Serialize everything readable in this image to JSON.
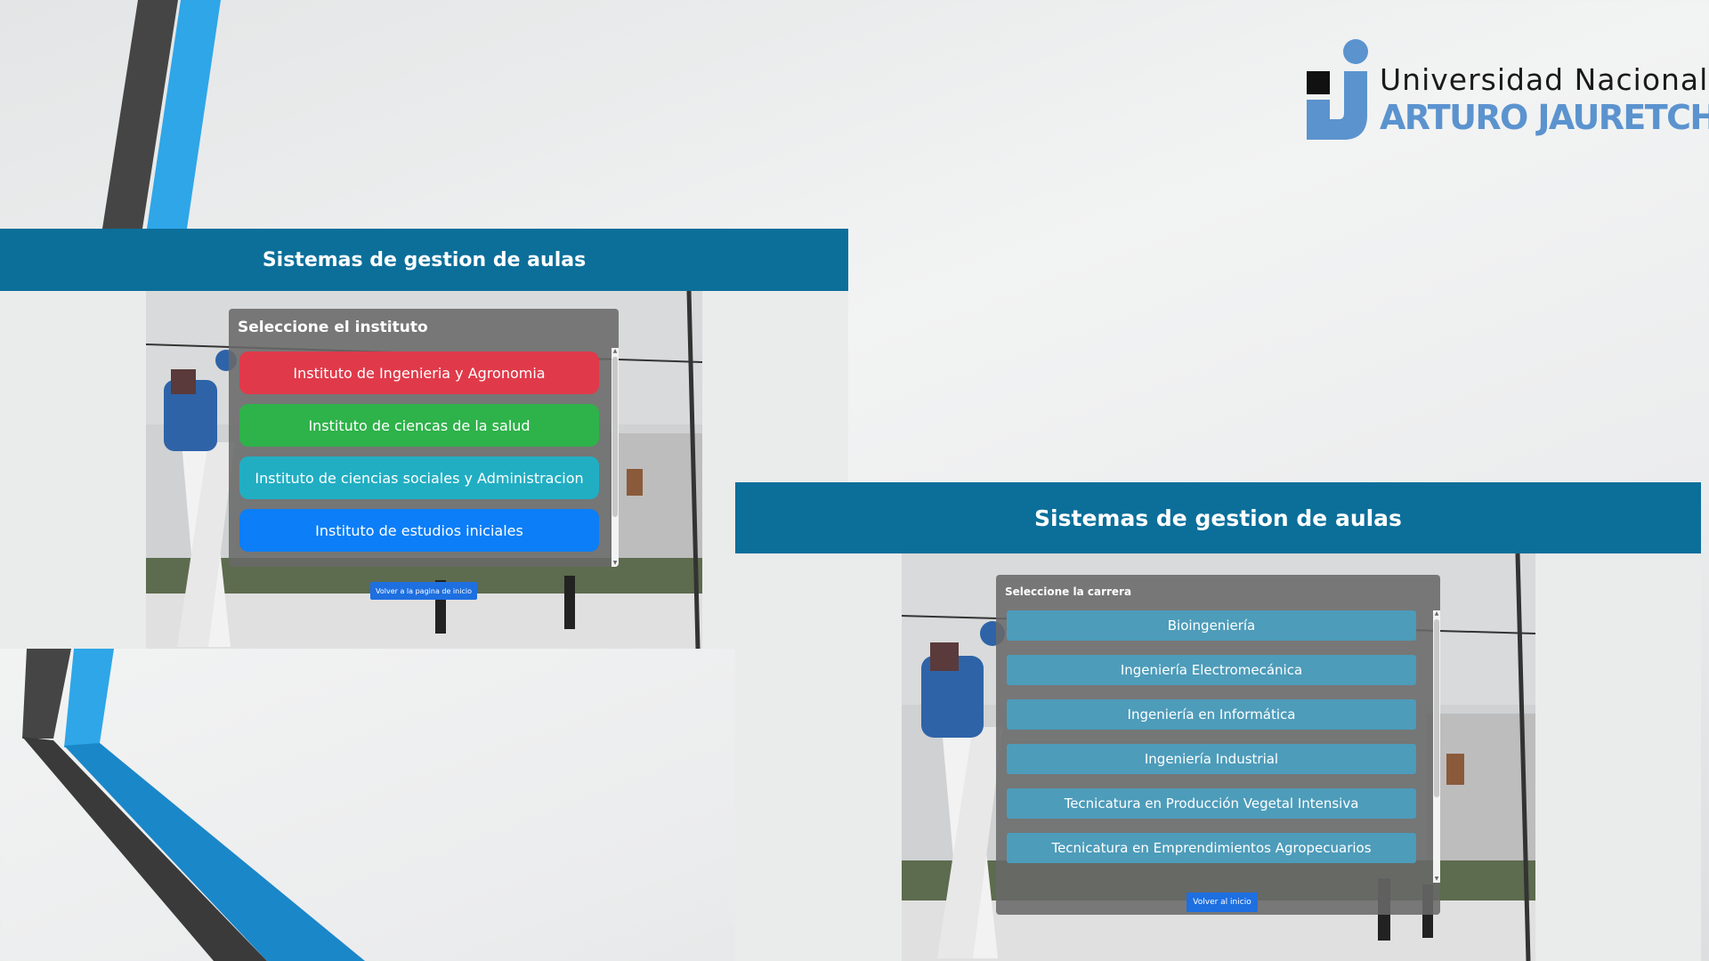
{
  "logo": {
    "line1": "Universidad Nacional",
    "line2": "ARTURO JAURETCHE",
    "mark_icon": "unaj-j-logo-icon"
  },
  "colors": {
    "header": "#0b6f9a",
    "accent_blue": "#2ea6e8",
    "deco_dark": "#454545",
    "logo_blue": "#5b93cf"
  },
  "screen_left": {
    "header_title": "Sistemas de gestion de aulas",
    "modal_title": "Seleccione el instituto",
    "options": [
      {
        "label": "Instituto de Ingenieria y Agronomia",
        "color": "#e03a4a"
      },
      {
        "label": "Instituto de ciencas de la salud",
        "color": "#2eb24a"
      },
      {
        "label": "Instituto de ciencias sociales y Administracion",
        "color": "#21aec3"
      },
      {
        "label": "Instituto de estudios iniciales",
        "color": "#0c7ef7"
      }
    ],
    "back_button": "Volver a la pagina de inicio"
  },
  "screen_right": {
    "header_title": "Sistemas de gestion de aulas",
    "modal_title": "Seleccione la carrera",
    "options": [
      {
        "label": "Bioingeniería"
      },
      {
        "label": "Ingeniería Electromecánica"
      },
      {
        "label": "Ingeniería en Informática"
      },
      {
        "label": "Ingeniería Industrial"
      },
      {
        "label": "Tecnicatura en Producción Vegetal Intensiva"
      },
      {
        "label": "Tecnicatura en Emprendimientos Agropecuarios"
      }
    ],
    "back_button": "Volver al inicio"
  }
}
